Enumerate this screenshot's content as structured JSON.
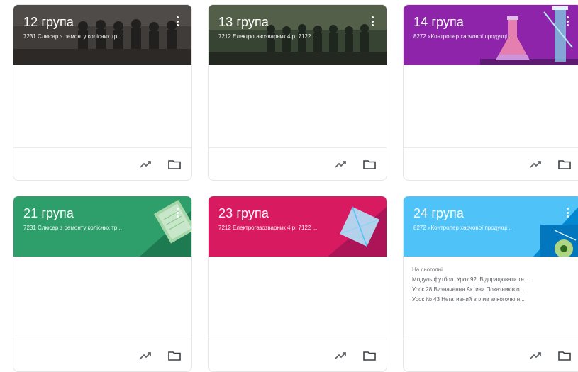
{
  "classes": [
    {
      "title": "12 група",
      "subtitle": "7231 Слюсар з ремонту колісних тр...",
      "banner_color": "#4b4846",
      "theme": "photo-people"
    },
    {
      "title": "13 група",
      "subtitle": "7212 Електрогазозварник 4 р. 7122 ...",
      "banner_color": "#3e4a3c",
      "theme": "photo-outdoor"
    },
    {
      "title": "14 група",
      "subtitle": "8272 «Контролер харчової продукці...",
      "banner_color": "#8e24aa",
      "theme": "science"
    },
    {
      "title": "21 група",
      "subtitle": "7231 Слюсар з ремонту колісних тр...",
      "banner_color": "#2e9e6a",
      "theme": "notebook"
    },
    {
      "title": "23 група",
      "subtitle": "7212 Електрогазозварник 4 р. 7122 ...",
      "banner_color": "#d81b60",
      "theme": "geometry"
    },
    {
      "title": "24 група",
      "subtitle": "8272 «Контролер харчової продукці...",
      "banner_color": "#4fc3f7",
      "theme": "biology",
      "upcoming": {
        "label": "На сьогодні",
        "items": [
          "Модуль футбол. Урок 92. Відпрацювати те...",
          "Урок 28 Визначення Активи Показників о...",
          "Урок № 43 Негативний вплив алкоголю н..."
        ]
      }
    }
  ],
  "icons": {
    "more": "more-vert-icon",
    "grades": "trending-up-icon",
    "folder": "folder-icon"
  }
}
